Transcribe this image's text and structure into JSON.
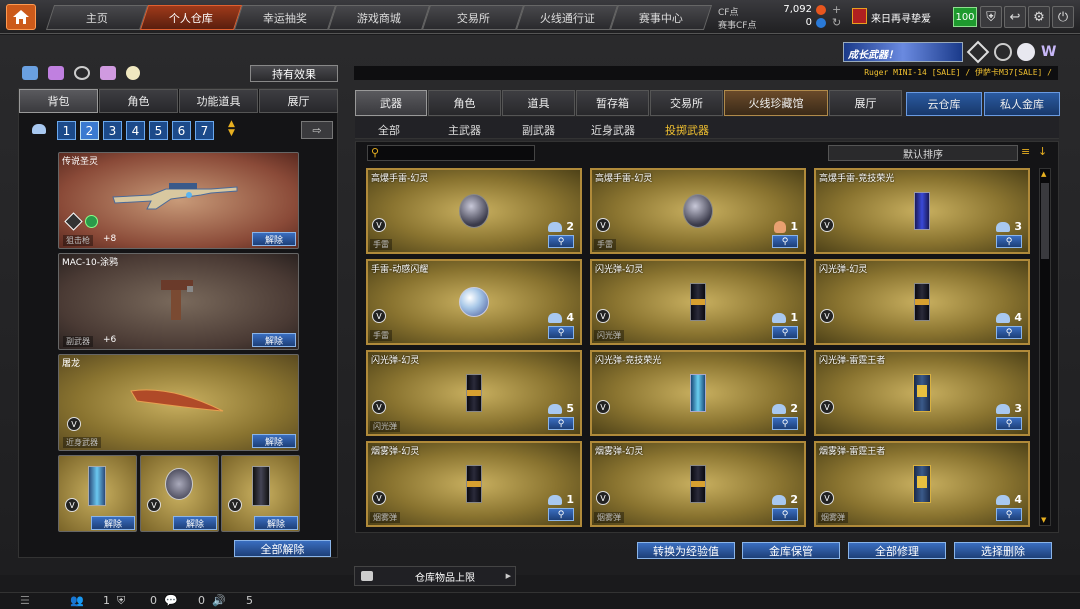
{
  "nav": {
    "tabs": [
      "主页",
      "个人仓库",
      "幸运抽奖",
      "游戏商城",
      "交易所",
      "火线通行证",
      "赛事中心"
    ],
    "active": 1
  },
  "currency": {
    "cf_label": "CF点",
    "cf_value": "7,092",
    "event_label": "赛事CF点",
    "event_value": "0"
  },
  "clan": {
    "name": "来日再寻挚爱"
  },
  "level": "100",
  "banner": {
    "text": "成长武器！",
    "marquee": "Ruger MINI-14 [SALE] / 伊萨卡M37[SALE] /"
  },
  "left": {
    "effects_button": "持有效果",
    "tabs": [
      "背包",
      "角色",
      "功能道具",
      "展厅"
    ],
    "pages": [
      "1",
      "2",
      "3",
      "4",
      "5",
      "6",
      "7"
    ],
    "active_page": 1,
    "equipped": [
      {
        "name": "传说圣灵",
        "tag": "狙击枪",
        "bonus": "+8",
        "release": "解除"
      },
      {
        "name": "MAC-10-涂鸦",
        "tag": "副武器",
        "bonus": "+6",
        "release": "解除"
      },
      {
        "name": "屠龙",
        "tag": "近身武器",
        "release": "解除"
      }
    ],
    "small_slots": [
      {
        "release": "解除"
      },
      {
        "release": "解除"
      },
      {
        "release": "解除"
      }
    ],
    "release_all": "全部解除"
  },
  "right": {
    "tabs": [
      "武器",
      "角色",
      "道具",
      "暂存箱",
      "交易所",
      "火线珍藏馆",
      "展厅"
    ],
    "active_tab": 0,
    "storage_tabs": [
      "云仓库",
      "私人金库"
    ],
    "subcategories": [
      "全部",
      "主武器",
      "副武器",
      "近身武器",
      "投掷武器"
    ],
    "active_sub": 4,
    "search_placeholder": "",
    "sort_label": "默认排序",
    "items": [
      {
        "name": "高爆手雷-幻灵",
        "type": "手雷",
        "count": "2",
        "kind": "cloud",
        "shape": "grenade"
      },
      {
        "name": "高爆手雷-幻灵",
        "type": "手雷",
        "count": "1",
        "kind": "user",
        "shape": "grenade"
      },
      {
        "name": "高爆手雷-竞技荣光",
        "type": "",
        "count": "3",
        "kind": "cloud",
        "shape": "canblue"
      },
      {
        "name": "手雷-动感闪耀",
        "type": "手雷",
        "count": "4",
        "kind": "cloud",
        "shape": "disco"
      },
      {
        "name": "闪光弹-幻灵",
        "type": "闪光弹",
        "count": "1",
        "kind": "cloud",
        "shape": "candark"
      },
      {
        "name": "闪光弹-幻灵",
        "type": "",
        "count": "4",
        "kind": "cloud",
        "shape": "candark"
      },
      {
        "name": "闪光弹-幻灵",
        "type": "闪光弹",
        "count": "5",
        "kind": "cloud",
        "shape": "candark"
      },
      {
        "name": "闪光弹-竞技荣光",
        "type": "",
        "count": "2",
        "kind": "cloud",
        "shape": "cancyan"
      },
      {
        "name": "闪光弹-雷霆王者",
        "type": "",
        "count": "3",
        "kind": "cloud",
        "shape": "cangold"
      },
      {
        "name": "烟雾弹-幻灵",
        "type": "烟雾弹",
        "count": "1",
        "kind": "cloud",
        "shape": "candark"
      },
      {
        "name": "烟雾弹-幻灵",
        "type": "烟雾弹",
        "count": "2",
        "kind": "cloud",
        "shape": "candark"
      },
      {
        "name": "烟雾弹-雷霆王者",
        "type": "烟雾弹",
        "count": "4",
        "kind": "cloud",
        "shape": "cangold"
      }
    ],
    "actions": [
      "转换为经验值",
      "金库保管",
      "全部修理",
      "选择删除"
    ]
  },
  "dropdown": {
    "label": "仓库物品上限"
  },
  "status": {
    "a": "1",
    "b": "0",
    "c": "0",
    "d": "5"
  }
}
